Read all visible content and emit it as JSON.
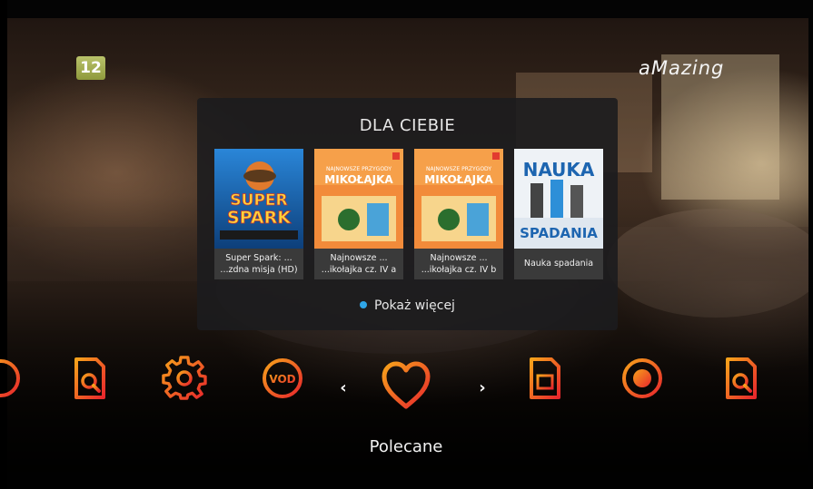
{
  "channel": {
    "number": "12"
  },
  "brand": {
    "logo_text": "aMazing"
  },
  "panel": {
    "title": "DLA CIEBIE",
    "items": [
      {
        "title": "Super Spark: ...",
        "subtitle": "...zdna misja (HD)",
        "poster_text": "SUPER SPARK",
        "poster_colors": [
          "#1f6fb5",
          "#f2b624"
        ]
      },
      {
        "title": "Najnowsze ...",
        "subtitle": "...ikołajka cz. IV a",
        "poster_text": "MIKOŁAJKA",
        "poster_colors": [
          "#f08a3a",
          "#ffd98a"
        ]
      },
      {
        "title": "Najnowsze ...",
        "subtitle": "...ikołajka cz. IV b",
        "poster_text": "MIKOŁAJKA",
        "poster_colors": [
          "#f08a3a",
          "#ffd98a"
        ]
      },
      {
        "title": "Nauka spadania",
        "subtitle": "",
        "poster_text": "NAUKA SPADANIA",
        "poster_colors": [
          "#e9eef4",
          "#2a6fb3"
        ]
      }
    ],
    "show_more": "Pokaż więcej"
  },
  "menu": {
    "selected_label": "Polecane",
    "prev_arrow": "‹",
    "next_arrow": "›",
    "icons": [
      {
        "name": "partial-left-icon"
      },
      {
        "name": "document-search-icon"
      },
      {
        "name": "gear-icon"
      },
      {
        "name": "vod-icon",
        "text": "VOD"
      },
      {
        "name": "heart-icon"
      },
      {
        "name": "document-list-icon"
      },
      {
        "name": "record-icon"
      },
      {
        "name": "document-search-icon"
      }
    ]
  },
  "colors": {
    "accent_start": "#e8272c",
    "accent_end": "#f7a21b",
    "dot": "#2fa6e8"
  }
}
